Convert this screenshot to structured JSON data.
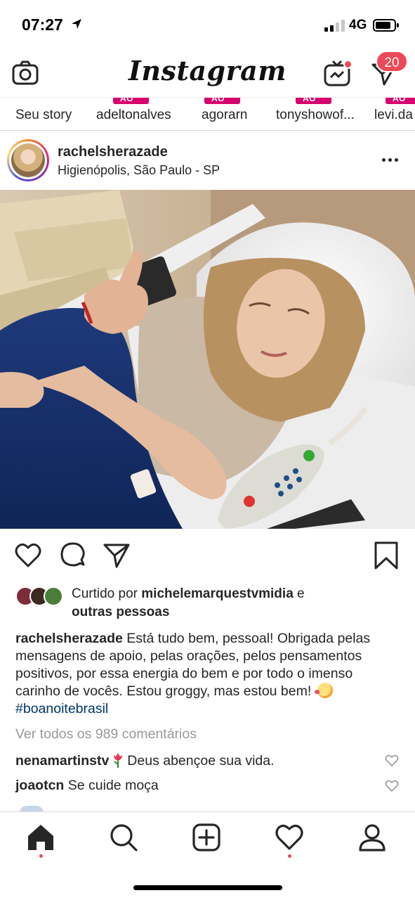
{
  "status_bar": {
    "time": "07:27",
    "network": "4G"
  },
  "header": {
    "logo": "Instagram",
    "dm_badge": "20",
    "accent": "#ed4956"
  },
  "stories": [
    {
      "name": "Seu story",
      "live": false
    },
    {
      "name": "adeltonalves",
      "live": true,
      "live_label": "AO VIVO"
    },
    {
      "name": "agorarn",
      "live": true,
      "live_label": "AO VIVO"
    },
    {
      "name": "tonyshowof...",
      "live": true,
      "live_label": "AO VIVO"
    },
    {
      "name": "levi.da",
      "live": true,
      "live_label": "AO VIVO"
    }
  ],
  "post": {
    "username": "rachelsherazade",
    "location": "Higienópolis, São Paulo - SP",
    "likes_prefix": "Curtido por ",
    "likes_user": "michelemarquestvmidia",
    "likes_joiner": " e",
    "likes_others": "outras pessoas",
    "caption_user": "rachelsherazade",
    "caption_text": "Está tudo bem, pessoal! Obrigada pelas mensagens de apoio, pelas orações, pelos pensamentos positivos, por essa energia do bem e por todo o imenso carinho de vocês. Estou groggy, mas estou bem!",
    "caption_hashtag": "#boanoitebrasil",
    "view_all": "Ver todos os 989 comentários",
    "comments": [
      {
        "user": "nenamartinstv",
        "text": "Deus abençoe sua vida.",
        "emoji": "tulip-icon"
      },
      {
        "user": "joaotcn",
        "text": "Se cuide moça"
      }
    ]
  }
}
